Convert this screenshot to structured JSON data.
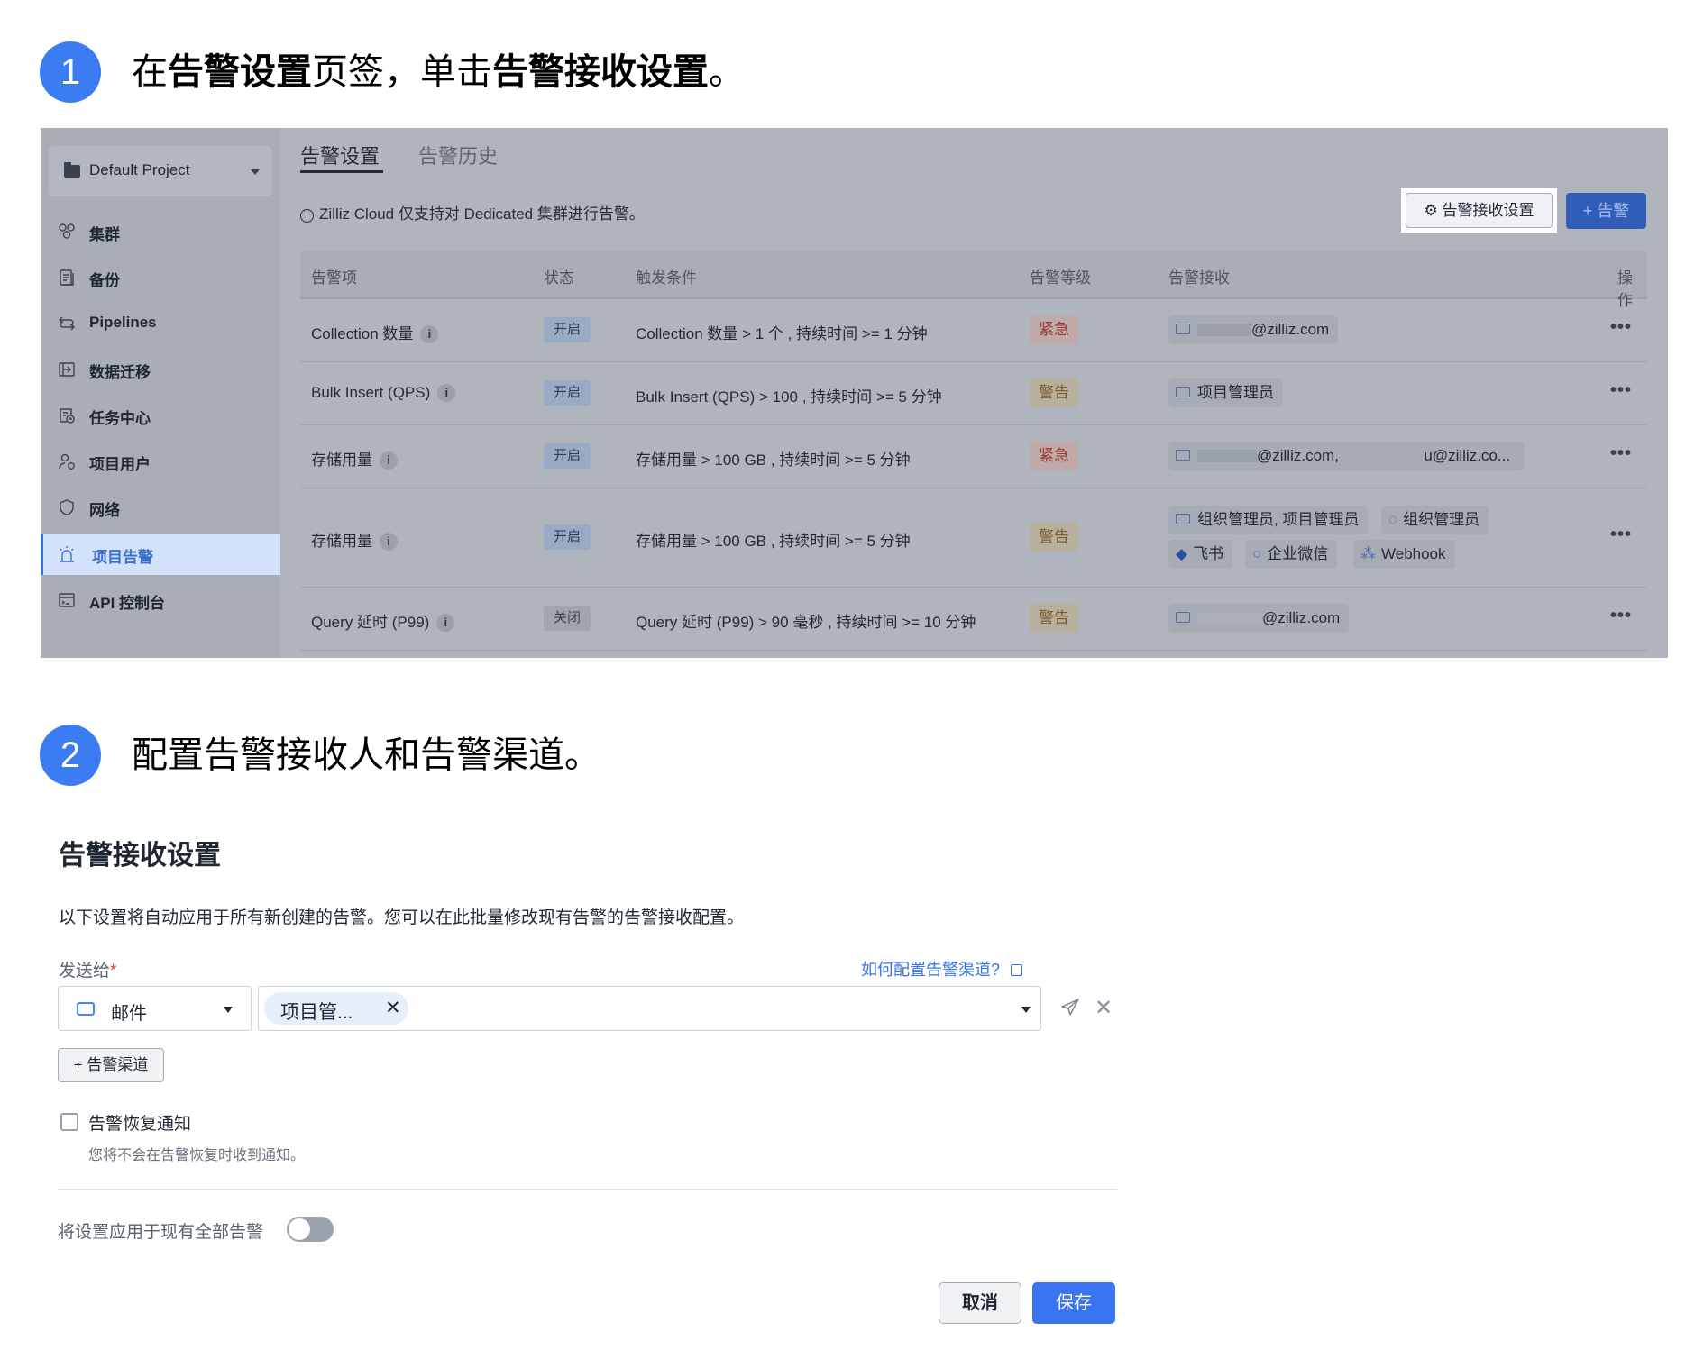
{
  "step1": {
    "number": "1",
    "text_parts": [
      {
        "text": "在",
        "bold": false
      },
      {
        "text": "告警设置",
        "bold": true
      },
      {
        "text": "页签，单击",
        "bold": false
      },
      {
        "text": "告警接收设置",
        "bold": true
      },
      {
        "text": "。",
        "bold": false
      }
    ]
  },
  "app": {
    "project_selector": "Default Project",
    "sidebar": [
      {
        "label": "集群",
        "icon": "cluster-icon",
        "active": false
      },
      {
        "label": "备份",
        "icon": "backup-icon",
        "active": false
      },
      {
        "label": "Pipelines",
        "icon": "pipelines-icon",
        "active": false
      },
      {
        "label": "数据迁移",
        "icon": "migration-icon",
        "active": false
      },
      {
        "label": "任务中心",
        "icon": "job-center-icon",
        "active": false
      },
      {
        "label": "项目用户",
        "icon": "project-users-icon",
        "active": false
      },
      {
        "label": "网络",
        "icon": "shield-icon",
        "active": false
      },
      {
        "label": "项目告警",
        "icon": "alarm-icon",
        "active": true
      },
      {
        "label": "API 控制台",
        "icon": "terminal-icon",
        "active": false
      }
    ],
    "tabs": [
      {
        "label": "告警设置",
        "active": true
      },
      {
        "label": "告警历史",
        "active": false
      }
    ],
    "info_text": "Zilliz Cloud 仅支持对 Dedicated 集群进行告警。",
    "recv_settings_button": "告警接收设置",
    "add_alert_button": "+ 告警",
    "table": {
      "columns": [
        "告警项",
        "状态",
        "触发条件",
        "告警等级",
        "告警接收",
        "操作"
      ],
      "rows": [
        {
          "item": "Collection 数量",
          "status": "开启",
          "status_type": "on",
          "condition": "Collection 数量 > 1 个 , 持续时间 >= 1 分钟",
          "level": "紧急",
          "level_type": "urgent",
          "receivers": [
            {
              "icon": "mail-icon",
              "text": "@zilliz.com",
              "redacted": true
            }
          ]
        },
        {
          "item": "Bulk Insert (QPS)",
          "status": "开启",
          "status_type": "on",
          "condition": "Bulk Insert (QPS) > 100 , 持续时间 >= 5 分钟",
          "level": "警告",
          "level_type": "warn",
          "receivers": [
            {
              "icon": "mail-icon",
              "text": "项目管理员",
              "redacted": false
            }
          ]
        },
        {
          "item": "存储用量",
          "status": "开启",
          "status_type": "on",
          "condition": "存储用量 > 100 GB , 持续时间 >= 5 分钟",
          "level": "紧急",
          "level_type": "urgent",
          "receivers": [
            {
              "icon": "mail-icon",
              "text": "@zilliz.com, ‍ ‍ ‍ ‍ ‍ ‍ ‍ ‍ ‍ ‍ ‍ ‍ ‍ ‍ ‍ ‍ ‍ ‍ ‍ ‍u@zilliz.co...",
              "redacted": true
            }
          ]
        },
        {
          "item": "存储用量",
          "status": "开启",
          "status_type": "on",
          "condition": "存储用量 > 100 GB , 持续时间 >= 5 分钟",
          "level": "警告",
          "level_type": "warn",
          "receivers": [
            {
              "icon": "mail-icon",
              "text": "组织管理员, 项目管理员",
              "redacted": false
            },
            {
              "icon": "chat-icon",
              "text": "组织管理员",
              "redacted": false
            },
            {
              "icon": "feishu-icon",
              "text": "飞书",
              "redacted": false
            },
            {
              "icon": "wecom-icon",
              "text": "企业微信",
              "redacted": false
            },
            {
              "icon": "webhook-icon",
              "text": "Webhook",
              "redacted": false
            }
          ]
        },
        {
          "item": "Query 延时 (P99)",
          "status": "关闭",
          "status_type": "off",
          "condition": "Query 延时 (P99) > 90 毫秒 , 持续时间 >= 10 分钟",
          "level": "警告",
          "level_type": "warn",
          "receivers": [
            {
              "icon": "mail-icon",
              "text": "@zilliz.com",
              "redacted": true
            }
          ]
        }
      ],
      "more_label": "•••"
    }
  },
  "step2": {
    "number": "2",
    "text": "配置告警接收人和告警渠道。"
  },
  "form": {
    "title": "告警接收设置",
    "description": "以下设置将自动应用于所有新创建的告警。您可以在此批量修改现有告警的告警接收配置。",
    "send_to_label": "发送给",
    "required_mark": "*",
    "help_link": "如何配置告警渠道?",
    "channel_select_value": "邮件",
    "recipient_tag": "项目管...",
    "tag_remove": "✕",
    "remove_row": "✕",
    "add_channel_button": "+ 告警渠道",
    "recovery_checkbox_label": "告警恢复通知",
    "recovery_checkbox_checked": false,
    "recovery_hint": "您将不会在告警恢复时收到通知。",
    "apply_all_label": "将设置应用于现有全部告警",
    "apply_all_enabled": false,
    "cancel_button": "取消",
    "save_button": "保存"
  }
}
